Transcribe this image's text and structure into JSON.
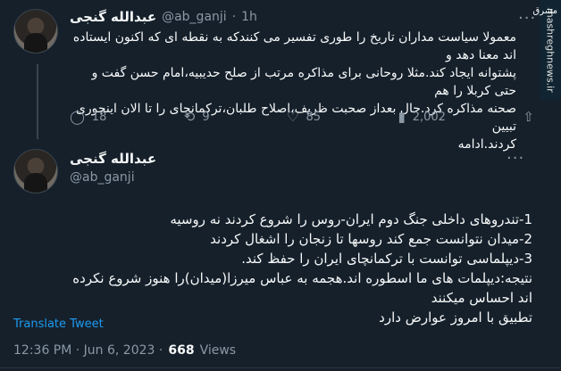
{
  "tweet1": {
    "name": "عبدالله گنجی",
    "handle": "@ab_ganji",
    "dot": "·",
    "time": "1h",
    "lines": [
      "معمولا سیاست مداران تاریخ را طوری تفسیر می کنندکه به نقطه ای که اکنون ایستاده اند معنا دهد و",
      "پشتوانه ایجاد کند.مثلا روحانی برای مذاکره مرتب از صلح حدیبیه،امام حسن گفت و حتی کربلا را هم",
      "صحنه مذاکره کرد.حال بعداز صحبت ظریف،اصلاح طلبان،ترکمانچای را تا الان اینجوری تبیین",
      "کردند.ادامه"
    ],
    "replies": "18",
    "retweets": "9",
    "likes": "85",
    "views": "2,002"
  },
  "tweet2": {
    "name": "عبدالله گنجی",
    "handle": "@ab_ganji",
    "lines": [
      "1-تندروهای داخلی جنگ دوم ایران-روس را شروع کردند نه روسیه",
      "2-میدان نتوانست جمع کند روسها تا زنجان را اشغال کردند",
      "3-دیپلماسی توانست با ترکمانچای ایران را حفظ کند.",
      "نتیجه:دیپلمات های ما اسطوره اند.هجمه به عباس میرزا(میدان)را هنوز شروع نکرده اند احساس میکنند",
      "تطبیق با امروز عوارض دارد"
    ],
    "translate": "Translate Tweet",
    "timestamp": "12:36 PM · Jun 6, 2023 ·",
    "views_count": "668",
    "views_label": "Views"
  },
  "watermark": {
    "brand": "مشرق",
    "site": "mashreghnews.ir"
  },
  "icons": {
    "more": "more-horizontal-icon",
    "reply": "reply-icon",
    "retweet": "retweet-icon",
    "like": "heart-icon",
    "views": "analytics-icon",
    "share": "share-icon"
  }
}
